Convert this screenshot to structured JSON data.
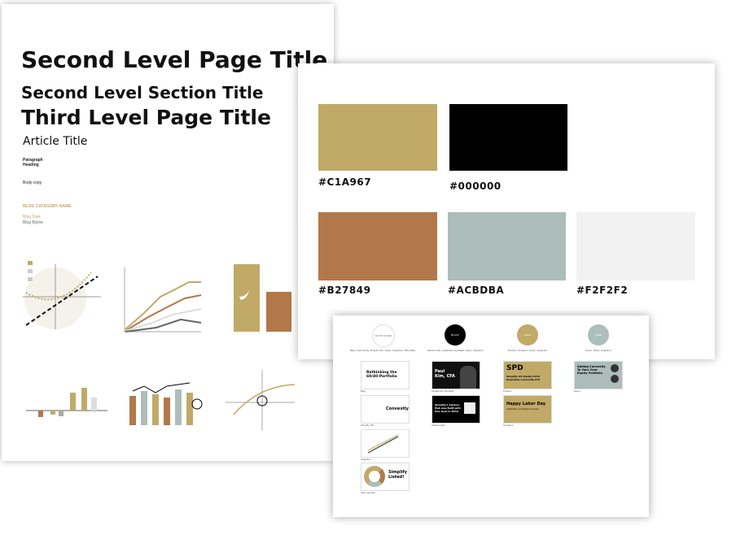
{
  "typography": {
    "h1": "Second Level Page Title",
    "h2": "Second Level Section Title",
    "h3": "Third Level Page Title",
    "article": "Article Title",
    "paragraph_heading": "Paragraph Heading",
    "body": "Body copy",
    "category": "BLOG CATEGORY NAME",
    "date": "Blog Date",
    "byline": "Blog Byline"
  },
  "colors": {
    "gold": "#C1A967",
    "black": "#000000",
    "copper": "#B27849",
    "sage": "#ACBDBA",
    "light": "#F2F2F2"
  },
  "swatches": [
    {
      "label": "#C1A967",
      "hex": "#C1A967"
    },
    {
      "label": "#000000",
      "hex": "#000000"
    },
    {
      "label": "#B27849",
      "hex": "#B27849"
    },
    {
      "label": "#ACBDBA",
      "hex": "#ACBDBA"
    },
    {
      "label": "#F2F2F2",
      "hex": "#F2F2F2"
    }
  ],
  "themes": [
    {
      "name": "WHITE SILVER",
      "usage": "Blog, Case Study, Simplify 101, News, Snapshot, TEG Table",
      "hex": "#ffffff"
    },
    {
      "name": "BLACK",
      "usage": "Advisor Hub, Leadership Spotlight, News, Snapshot",
      "hex": "#000000"
    },
    {
      "name": "GOLD",
      "usage": "Product, Occasion, News, Snapshot",
      "hex": "#C1A967"
    },
    {
      "name": "SAGE",
      "usage": "Event, News, Snapshot",
      "hex": "#ACBDBA"
    }
  ],
  "thumbnails": [
    {
      "title": "Rethinking the 60/40 Portfolio",
      "caption": "Blog"
    },
    {
      "title": "Convexity",
      "caption": "Simplify 101"
    },
    {
      "title": "",
      "caption": "Snapshot"
    },
    {
      "title": "Simplify Listed!",
      "caption": "Story Launch"
    },
    {
      "title": "Paul Kim, CFA",
      "caption": "Leadership Spotlight"
    },
    {
      "title": "Simplify's Advisor Hub was Built with One Goal in Mind",
      "caption": "Advisor Hub"
    },
    {
      "title": "SPD",
      "subtitle": "Simplify US Equity PLUS Downside Convexity ETF",
      "caption": "Product"
    },
    {
      "title": "Happy Labor Day",
      "subtitle": "Celebrate your family's success.",
      "caption": "Occasion"
    },
    {
      "title": "Adding Convexity To Your Core Equity Portfolio",
      "caption": "Event"
    }
  ]
}
